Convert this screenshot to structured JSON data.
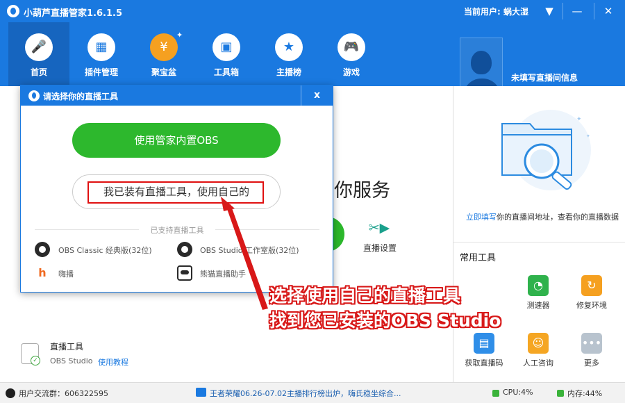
{
  "app": {
    "title": "小葫芦直播管家1.6.1.5",
    "current_user": "当前用户: 蜗大湿"
  },
  "nav": {
    "items": [
      {
        "label": "首页",
        "icon": "microphone-icon"
      },
      {
        "label": "插件管理",
        "icon": "puzzle-icon"
      },
      {
        "label": "聚宝盆",
        "icon": "money-bag-icon"
      },
      {
        "label": "工具箱",
        "icon": "toolbox-icon"
      },
      {
        "label": "主播榜",
        "icon": "medal-icon"
      },
      {
        "label": "游戏",
        "icon": "gamepad-icon"
      }
    ],
    "room_info": "未填写直播间信息"
  },
  "main": {
    "bg_service_text": "你服务",
    "bg_setting_label": "直播设置",
    "live_tool": {
      "title": "直播工具",
      "name": "OBS Studio",
      "link": "使用教程"
    }
  },
  "right": {
    "fill_link": "立即填写",
    "fill_text": "你的直播间地址，查看你的直播数据",
    "tools_title": "常用工具",
    "tools": [
      {
        "label": "测速器",
        "icon": "speedometer-icon",
        "color": "#2fb24c"
      },
      {
        "label": "修复环境",
        "icon": "wrench-icon",
        "color": "#f5a020"
      },
      {
        "label": "获取直播码",
        "icon": "qr-code-icon",
        "color": "#2f8ee8"
      },
      {
        "label": "人工咨询",
        "icon": "chat-icon",
        "color": "#f5a623"
      },
      {
        "label": "更多",
        "icon": "more-icon",
        "color": "#b8c3ce"
      }
    ]
  },
  "dialog": {
    "title": "请选择你的直播工具",
    "close": "x",
    "btn_builtin_obs": "使用管家内置OBS",
    "btn_use_own": "我已装有直播工具，使用自己的",
    "supported_label": "已支持直播工具",
    "software": [
      {
        "label": "OBS Classic 经典版(32位)",
        "icon": "obs-icon"
      },
      {
        "label": "OBS Studio 工作室版(32位)",
        "icon": "obs-icon"
      },
      {
        "label": "嗨播",
        "icon": "haibo-icon"
      },
      {
        "label": "熊猫直播助手",
        "icon": "panda-icon"
      }
    ]
  },
  "annotation": {
    "line1": "选择使用自己的直播工具",
    "line2": "找到您已安装的OBS Studio"
  },
  "status": {
    "group": "用户交流群：606322595",
    "news": "王者荣耀06.26-07.02主播排行榜出炉，嗨氏稳坐综合...",
    "cpu": "CPU:4%",
    "mem": "内存:44%"
  }
}
